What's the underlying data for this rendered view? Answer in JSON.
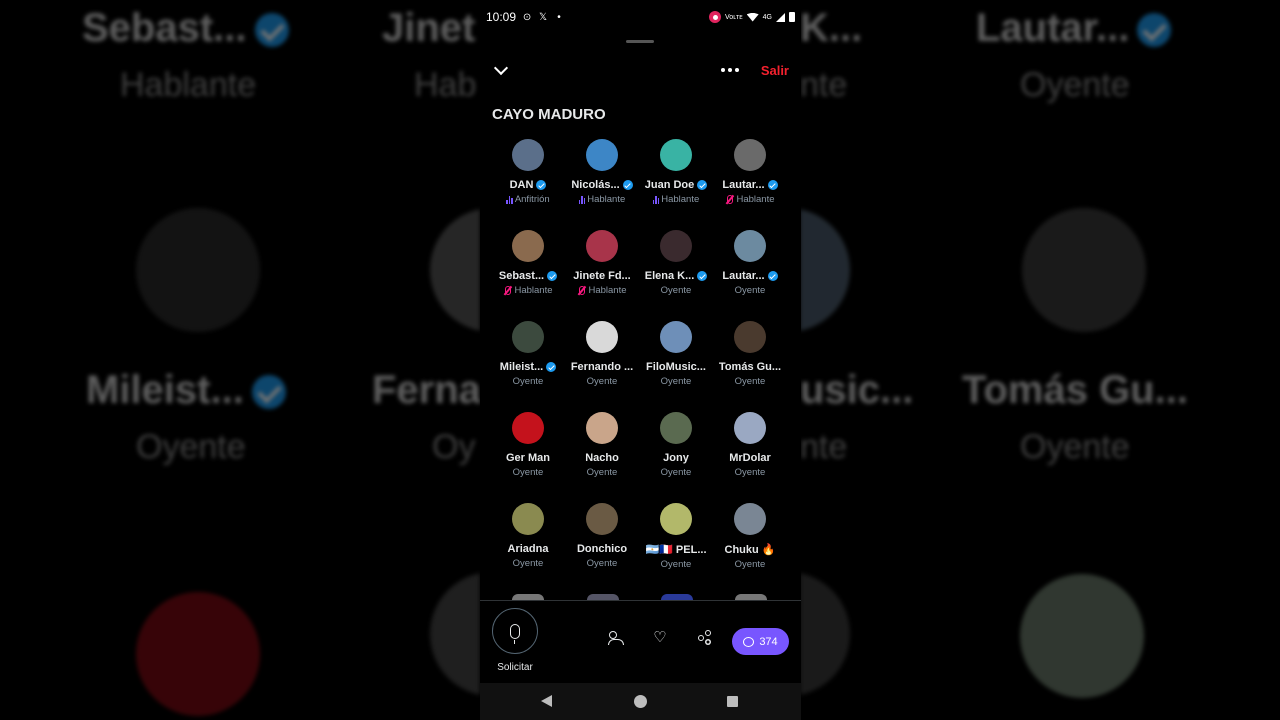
{
  "status_bar": {
    "time": "10:09",
    "network": "4G",
    "carrier_label": "Voʟᴛᴇ"
  },
  "space": {
    "title": "CAYO MADURO",
    "exit_label": "Salir",
    "more_icon": "more-horizontal-icon",
    "collapse_icon": "chevron-down-icon"
  },
  "participants": [
    {
      "name": "DAN",
      "verified": true,
      "role": "Anfitrión",
      "indicator": "speaking",
      "avatar_color": "#5b6f8a"
    },
    {
      "name": "Nicolás...",
      "verified": true,
      "role": "Hablante",
      "indicator": "speaking",
      "avatar_color": "#3d86c6"
    },
    {
      "name": "Juan Doe",
      "verified": true,
      "role": "Hablante",
      "indicator": "speaking",
      "avatar_color": "#39b3a4"
    },
    {
      "name": "Lautar...",
      "verified": true,
      "role": "Hablante",
      "indicator": "muted",
      "avatar_color": "#6a6a6a"
    },
    {
      "name": "Sebast...",
      "verified": true,
      "role": "Hablante",
      "indicator": "muted",
      "avatar_color": "#8a6a4e"
    },
    {
      "name": "Jinete Fd...",
      "verified": false,
      "role": "Hablante",
      "indicator": "muted",
      "avatar_color": "#a8344a"
    },
    {
      "name": "Elena K...",
      "verified": true,
      "role": "Oyente",
      "indicator": "none",
      "avatar_color": "#3a2a2e"
    },
    {
      "name": "Lautar...",
      "verified": true,
      "role": "Oyente",
      "indicator": "none",
      "avatar_color": "#6c8aa0"
    },
    {
      "name": "Mileist...",
      "verified": true,
      "role": "Oyente",
      "indicator": "none",
      "avatar_color": "#3c4a3e"
    },
    {
      "name": "Fernando ...",
      "verified": false,
      "role": "Oyente",
      "indicator": "none",
      "avatar_color": "#d9d9d9"
    },
    {
      "name": "FiloMusic...",
      "verified": false,
      "role": "Oyente",
      "indicator": "none",
      "avatar_color": "#6e8fb8"
    },
    {
      "name": "Tomás Gu...",
      "verified": false,
      "role": "Oyente",
      "indicator": "none",
      "avatar_color": "#4a3a2e"
    },
    {
      "name": "Ger Man",
      "verified": false,
      "role": "Oyente",
      "indicator": "none",
      "avatar_color": "#c4121c"
    },
    {
      "name": "Nacho",
      "verified": false,
      "role": "Oyente",
      "indicator": "none",
      "avatar_color": "#c9a58a"
    },
    {
      "name": "Jony",
      "verified": false,
      "role": "Oyente",
      "indicator": "none",
      "avatar_color": "#5a6a50"
    },
    {
      "name": "MrDolar",
      "verified": false,
      "role": "Oyente",
      "indicator": "none",
      "avatar_color": "#9aa8c2"
    },
    {
      "name": "Ariadna",
      "verified": false,
      "role": "Oyente",
      "indicator": "none",
      "avatar_color": "#8a8a50"
    },
    {
      "name": "Donchico",
      "verified": false,
      "role": "Oyente",
      "indicator": "none",
      "avatar_color": "#6a5a44"
    },
    {
      "name": "🇦🇷🇫🇷 PEL...",
      "verified": false,
      "role": "Oyente",
      "indicator": "none",
      "avatar_color": "#b2b86a"
    },
    {
      "name": "Chuku 🔥",
      "verified": false,
      "role": "Oyente",
      "indicator": "none",
      "avatar_color": "#7a8694"
    }
  ],
  "bottom_bar": {
    "request_label": "Solicitar",
    "chat_count": "374",
    "people_icon": "people-icon",
    "heart_icon": "heart-plus-icon",
    "share_icon": "share-icon",
    "chat_icon": "chat-bubble-icon"
  },
  "background": {
    "left": {
      "name1": "Sebast...",
      "role1": "Hablante",
      "name2": "Mileist...",
      "role2": "Oyente",
      "name3": "Jinet",
      "role3": "Hab",
      "name4": "Ferna",
      "role4": "Oy"
    },
    "right": {
      "name1": "Lautar...",
      "role1": "Oyente",
      "name2": "Tomás Gu...",
      "role2": "Oyente",
      "name3": "K...",
      "role3": "nte",
      "name4": "usic...",
      "role4": "nte"
    }
  }
}
